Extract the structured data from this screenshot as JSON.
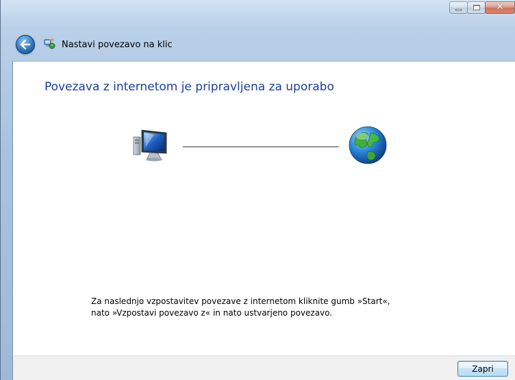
{
  "window": {
    "title": "Nastavi povezavo na klic",
    "controls": {
      "minimize_icon": "minimize-icon",
      "maximize_icon": "maximize-icon",
      "close_glyph": "✕"
    }
  },
  "nav": {
    "back_icon": "back-arrow-icon",
    "title_icon": "network-connection-icon"
  },
  "main": {
    "heading": "Povezava z internetom je pripravljena za uporabo",
    "diagram": {
      "left_icon": "computer-icon",
      "right_icon": "globe-icon",
      "line_color": "#3c3c3c"
    },
    "instruction_lines": [
      "Za naslednjo vzpostavitev povezave z internetom kliknite gumb »Start«,",
      "nato »Vzpostavi povezavo z« in nato ustvarjeno povezavo."
    ]
  },
  "footer": {
    "close_label": "Zapri"
  },
  "colors": {
    "heading": "#1a3e9a",
    "frame": "#a9c3df",
    "footer_bg": "#f0f0f0",
    "button_border": "#3c7fb1"
  }
}
